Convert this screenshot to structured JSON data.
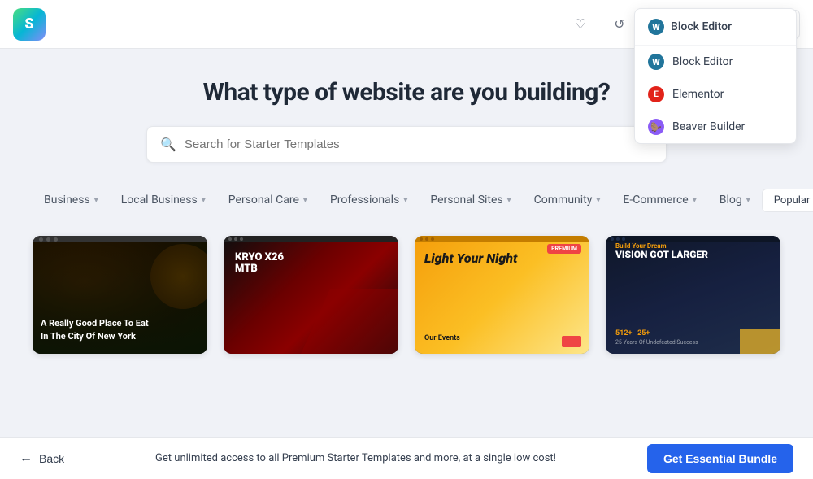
{
  "header": {
    "logo_text": "S",
    "heart_icon": "♡",
    "refresh_icon": "↺",
    "external_icon": "⧉",
    "dropdown": {
      "trigger_label": "Block Editor",
      "chevron": "▾",
      "items": [
        {
          "id": "block-editor",
          "label": "Block Editor",
          "icon_type": "wp"
        },
        {
          "id": "elementor",
          "label": "Elementor",
          "icon_type": "elementor"
        },
        {
          "id": "beaver-builder",
          "label": "Beaver Builder",
          "icon_type": "beaver"
        }
      ]
    }
  },
  "main": {
    "title": "What type of website are you building?",
    "search": {
      "placeholder": "Search for Starter Templates"
    },
    "filter_tabs": [
      {
        "id": "business",
        "label": "Business"
      },
      {
        "id": "local-business",
        "label": "Local Business"
      },
      {
        "id": "personal-care",
        "label": "Personal Care"
      },
      {
        "id": "professionals",
        "label": "Professionals"
      },
      {
        "id": "personal-sites",
        "label": "Personal Sites"
      },
      {
        "id": "community",
        "label": "Community"
      },
      {
        "id": "e-commerce",
        "label": "E-Commerce"
      },
      {
        "id": "blog",
        "label": "Blog"
      }
    ],
    "popular_label": "Popular",
    "templates": [
      {
        "id": "restaurant",
        "title": "A Really Good Place To Eat\nIn The City Of New York",
        "theme": "restaurant"
      },
      {
        "id": "bike",
        "title": "KRYO X26\nMTB",
        "theme": "bike"
      },
      {
        "id": "event",
        "title": "Light Your Night",
        "badge": "PREMIUM",
        "theme": "event"
      },
      {
        "id": "vision",
        "title": "VISION GOT LARGER",
        "subtitle": "Build Your Dream",
        "stats": "512+   25+",
        "stats_sub": "25 Years Of Undefeated\nSuccess",
        "theme": "vision"
      }
    ]
  },
  "bottom_bar": {
    "back_label": "Back",
    "promo_text": "Get unlimited access to all Premium Starter Templates and more, at a single low cost!",
    "bundle_button_label": "Get Essential Bundle"
  }
}
